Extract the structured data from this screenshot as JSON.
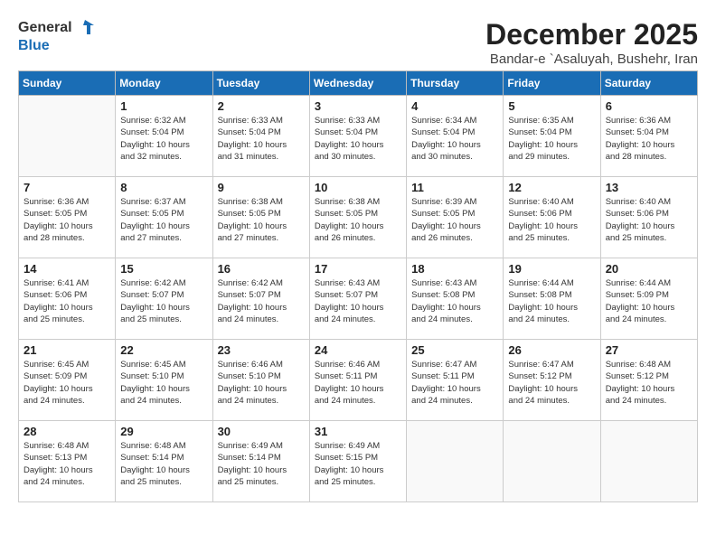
{
  "logo": {
    "general": "General",
    "blue": "Blue"
  },
  "title": "December 2025",
  "location": "Bandar-e `Asaluyah, Bushehr, Iran",
  "days_header": [
    "Sunday",
    "Monday",
    "Tuesday",
    "Wednesday",
    "Thursday",
    "Friday",
    "Saturday"
  ],
  "weeks": [
    [
      {
        "day": "",
        "info": ""
      },
      {
        "day": "1",
        "info": "Sunrise: 6:32 AM\nSunset: 5:04 PM\nDaylight: 10 hours\nand 32 minutes."
      },
      {
        "day": "2",
        "info": "Sunrise: 6:33 AM\nSunset: 5:04 PM\nDaylight: 10 hours\nand 31 minutes."
      },
      {
        "day": "3",
        "info": "Sunrise: 6:33 AM\nSunset: 5:04 PM\nDaylight: 10 hours\nand 30 minutes."
      },
      {
        "day": "4",
        "info": "Sunrise: 6:34 AM\nSunset: 5:04 PM\nDaylight: 10 hours\nand 30 minutes."
      },
      {
        "day": "5",
        "info": "Sunrise: 6:35 AM\nSunset: 5:04 PM\nDaylight: 10 hours\nand 29 minutes."
      },
      {
        "day": "6",
        "info": "Sunrise: 6:36 AM\nSunset: 5:04 PM\nDaylight: 10 hours\nand 28 minutes."
      }
    ],
    [
      {
        "day": "7",
        "info": "Sunrise: 6:36 AM\nSunset: 5:05 PM\nDaylight: 10 hours\nand 28 minutes."
      },
      {
        "day": "8",
        "info": "Sunrise: 6:37 AM\nSunset: 5:05 PM\nDaylight: 10 hours\nand 27 minutes."
      },
      {
        "day": "9",
        "info": "Sunrise: 6:38 AM\nSunset: 5:05 PM\nDaylight: 10 hours\nand 27 minutes."
      },
      {
        "day": "10",
        "info": "Sunrise: 6:38 AM\nSunset: 5:05 PM\nDaylight: 10 hours\nand 26 minutes."
      },
      {
        "day": "11",
        "info": "Sunrise: 6:39 AM\nSunset: 5:05 PM\nDaylight: 10 hours\nand 26 minutes."
      },
      {
        "day": "12",
        "info": "Sunrise: 6:40 AM\nSunset: 5:06 PM\nDaylight: 10 hours\nand 25 minutes."
      },
      {
        "day": "13",
        "info": "Sunrise: 6:40 AM\nSunset: 5:06 PM\nDaylight: 10 hours\nand 25 minutes."
      }
    ],
    [
      {
        "day": "14",
        "info": "Sunrise: 6:41 AM\nSunset: 5:06 PM\nDaylight: 10 hours\nand 25 minutes."
      },
      {
        "day": "15",
        "info": "Sunrise: 6:42 AM\nSunset: 5:07 PM\nDaylight: 10 hours\nand 25 minutes."
      },
      {
        "day": "16",
        "info": "Sunrise: 6:42 AM\nSunset: 5:07 PM\nDaylight: 10 hours\nand 24 minutes."
      },
      {
        "day": "17",
        "info": "Sunrise: 6:43 AM\nSunset: 5:07 PM\nDaylight: 10 hours\nand 24 minutes."
      },
      {
        "day": "18",
        "info": "Sunrise: 6:43 AM\nSunset: 5:08 PM\nDaylight: 10 hours\nand 24 minutes."
      },
      {
        "day": "19",
        "info": "Sunrise: 6:44 AM\nSunset: 5:08 PM\nDaylight: 10 hours\nand 24 minutes."
      },
      {
        "day": "20",
        "info": "Sunrise: 6:44 AM\nSunset: 5:09 PM\nDaylight: 10 hours\nand 24 minutes."
      }
    ],
    [
      {
        "day": "21",
        "info": "Sunrise: 6:45 AM\nSunset: 5:09 PM\nDaylight: 10 hours\nand 24 minutes."
      },
      {
        "day": "22",
        "info": "Sunrise: 6:45 AM\nSunset: 5:10 PM\nDaylight: 10 hours\nand 24 minutes."
      },
      {
        "day": "23",
        "info": "Sunrise: 6:46 AM\nSunset: 5:10 PM\nDaylight: 10 hours\nand 24 minutes."
      },
      {
        "day": "24",
        "info": "Sunrise: 6:46 AM\nSunset: 5:11 PM\nDaylight: 10 hours\nand 24 minutes."
      },
      {
        "day": "25",
        "info": "Sunrise: 6:47 AM\nSunset: 5:11 PM\nDaylight: 10 hours\nand 24 minutes."
      },
      {
        "day": "26",
        "info": "Sunrise: 6:47 AM\nSunset: 5:12 PM\nDaylight: 10 hours\nand 24 minutes."
      },
      {
        "day": "27",
        "info": "Sunrise: 6:48 AM\nSunset: 5:12 PM\nDaylight: 10 hours\nand 24 minutes."
      }
    ],
    [
      {
        "day": "28",
        "info": "Sunrise: 6:48 AM\nSunset: 5:13 PM\nDaylight: 10 hours\nand 24 minutes."
      },
      {
        "day": "29",
        "info": "Sunrise: 6:48 AM\nSunset: 5:14 PM\nDaylight: 10 hours\nand 25 minutes."
      },
      {
        "day": "30",
        "info": "Sunrise: 6:49 AM\nSunset: 5:14 PM\nDaylight: 10 hours\nand 25 minutes."
      },
      {
        "day": "31",
        "info": "Sunrise: 6:49 AM\nSunset: 5:15 PM\nDaylight: 10 hours\nand 25 minutes."
      },
      {
        "day": "",
        "info": ""
      },
      {
        "day": "",
        "info": ""
      },
      {
        "day": "",
        "info": ""
      }
    ]
  ]
}
